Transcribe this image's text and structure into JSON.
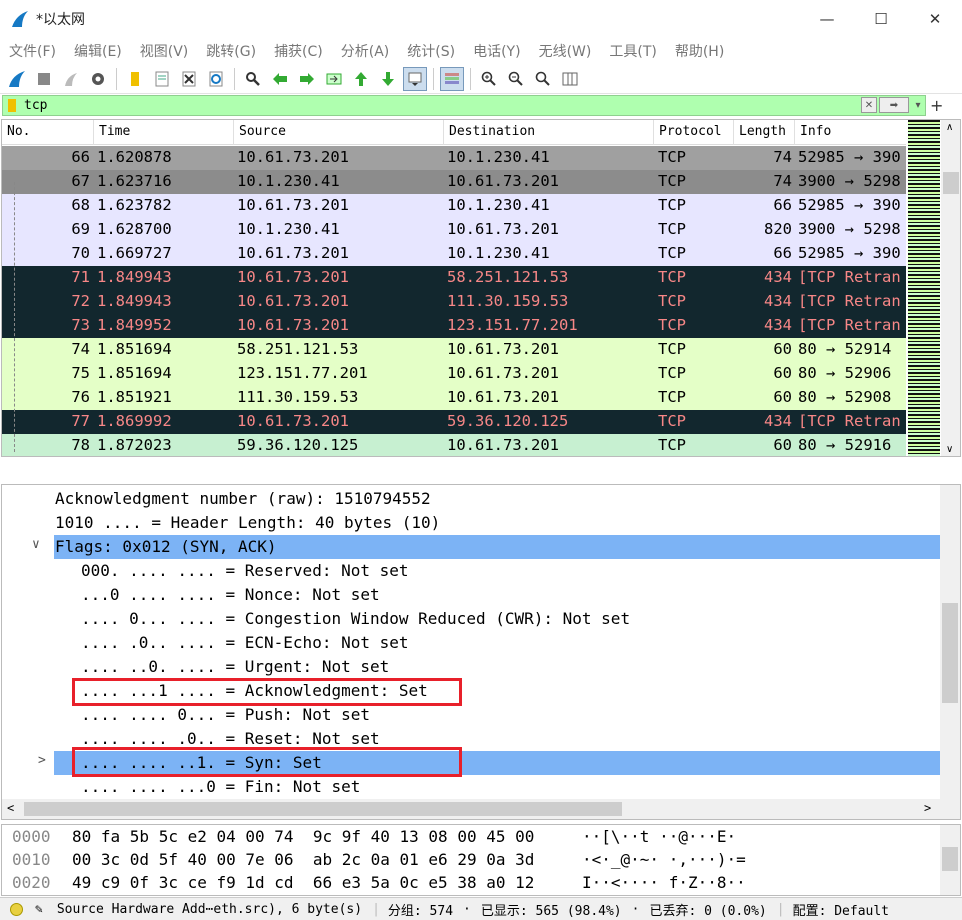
{
  "window": {
    "title": "*以太网",
    "minimize": "—",
    "maximize": "☐",
    "close": "✕"
  },
  "menu": [
    "文件(F)",
    "编辑(E)",
    "视图(V)",
    "跳转(G)",
    "捕获(C)",
    "分析(A)",
    "统计(S)",
    "电话(Y)",
    "无线(W)",
    "工具(T)",
    "帮助(H)"
  ],
  "filter": {
    "value": "tcp",
    "plus": "+"
  },
  "columns": [
    "No.",
    "Time",
    "Source",
    "Destination",
    "Protocol",
    "Length",
    "Info"
  ],
  "packets": [
    {
      "no": "66",
      "time": "1.620878",
      "src": "10.61.73.201",
      "dst": "10.1.230.41",
      "proto": "TCP",
      "len": "74",
      "info": "52985 → 390",
      "bg": "#a0a0a0",
      "fg": "#000"
    },
    {
      "no": "67",
      "time": "1.623716",
      "src": "10.1.230.41",
      "dst": "10.61.73.201",
      "proto": "TCP",
      "len": "74",
      "info": "3900 → 5298",
      "bg": "#8c8c8c",
      "fg": "#000"
    },
    {
      "no": "68",
      "time": "1.623782",
      "src": "10.61.73.201",
      "dst": "10.1.230.41",
      "proto": "TCP",
      "len": "66",
      "info": "52985 → 390",
      "bg": "#e7e6ff",
      "fg": "#000"
    },
    {
      "no": "69",
      "time": "1.628700",
      "src": "10.1.230.41",
      "dst": "10.61.73.201",
      "proto": "TCP",
      "len": "820",
      "info": "3900 → 5298",
      "bg": "#e7e6ff",
      "fg": "#000"
    },
    {
      "no": "70",
      "time": "1.669727",
      "src": "10.61.73.201",
      "dst": "10.1.230.41",
      "proto": "TCP",
      "len": "66",
      "info": "52985 → 390",
      "bg": "#e7e6ff",
      "fg": "#000"
    },
    {
      "no": "71",
      "time": "1.849943",
      "src": "10.61.73.201",
      "dst": "58.251.121.53",
      "proto": "TCP",
      "len": "434",
      "info": "[TCP Retran",
      "bg": "#12272e",
      "fg": "#f78787"
    },
    {
      "no": "72",
      "time": "1.849943",
      "src": "10.61.73.201",
      "dst": "111.30.159.53",
      "proto": "TCP",
      "len": "434",
      "info": "[TCP Retran",
      "bg": "#12272e",
      "fg": "#f78787"
    },
    {
      "no": "73",
      "time": "1.849952",
      "src": "10.61.73.201",
      "dst": "123.151.77.201",
      "proto": "TCP",
      "len": "434",
      "info": "[TCP Retran",
      "bg": "#12272e",
      "fg": "#f78787"
    },
    {
      "no": "74",
      "time": "1.851694",
      "src": "58.251.121.53",
      "dst": "10.61.73.201",
      "proto": "TCP",
      "len": "60",
      "info": "80 → 52914",
      "bg": "#e4ffc7",
      "fg": "#000"
    },
    {
      "no": "75",
      "time": "1.851694",
      "src": "123.151.77.201",
      "dst": "10.61.73.201",
      "proto": "TCP",
      "len": "60",
      "info": "80 → 52906",
      "bg": "#e4ffc7",
      "fg": "#000"
    },
    {
      "no": "76",
      "time": "1.851921",
      "src": "111.30.159.53",
      "dst": "10.61.73.201",
      "proto": "TCP",
      "len": "60",
      "info": "80 → 52908",
      "bg": "#e4ffc7",
      "fg": "#000"
    },
    {
      "no": "77",
      "time": "1.869992",
      "src": "10.61.73.201",
      "dst": "59.36.120.125",
      "proto": "TCP",
      "len": "434",
      "info": "[TCP Retran",
      "bg": "#12272e",
      "fg": "#f78787"
    },
    {
      "no": "78",
      "time": "1.872023",
      "src": "59.36.120.125",
      "dst": "10.61.73.201",
      "proto": "TCP",
      "len": "60",
      "info": "80 → 52916",
      "bg": "#c7f0d1",
      "fg": "#000"
    }
  ],
  "details": [
    {
      "indent": 0,
      "text": "Acknowledgment number (raw): 1510794552",
      "sel": false,
      "arrow": ""
    },
    {
      "indent": 0,
      "text": "1010 .... = Header Length: 40 bytes (10)",
      "sel": false,
      "arrow": ""
    },
    {
      "indent": 0,
      "text": "Flags: 0x012 (SYN, ACK)",
      "sel": true,
      "arrow": "∨"
    },
    {
      "indent": 1,
      "text": "000. .... .... = Reserved: Not set",
      "sel": false,
      "arrow": ""
    },
    {
      "indent": 1,
      "text": "...0 .... .... = Nonce: Not set",
      "sel": false,
      "arrow": ""
    },
    {
      "indent": 1,
      "text": ".... 0... .... = Congestion Window Reduced (CWR): Not set",
      "sel": false,
      "arrow": ""
    },
    {
      "indent": 1,
      "text": ".... .0.. .... = ECN-Echo: Not set",
      "sel": false,
      "arrow": ""
    },
    {
      "indent": 1,
      "text": ".... ..0. .... = Urgent: Not set",
      "sel": false,
      "arrow": ""
    },
    {
      "indent": 1,
      "text": ".... ...1 .... = Acknowledgment: Set",
      "sel": false,
      "arrow": ""
    },
    {
      "indent": 1,
      "text": ".... .... 0... = Push: Not set",
      "sel": false,
      "arrow": ""
    },
    {
      "indent": 1,
      "text": ".... .... .0.. = Reset: Not set",
      "sel": false,
      "arrow": ""
    },
    {
      "indent": 1,
      "text": ".... .... ..1. = Syn: Set",
      "sel": true,
      "arrow": ">"
    },
    {
      "indent": 1,
      "text": ".... .... ...0 = Fin: Not set",
      "sel": false,
      "arrow": ""
    }
  ],
  "bytes": [
    {
      "off": "0000",
      "hex": "80 fa 5b 5c e2 04 00 74  9c 9f 40 13 08 00 45 00",
      "ascii": "··[\\··t ··@···E·"
    },
    {
      "off": "0010",
      "hex": "00 3c 0d 5f 40 00 7e 06  ab 2c 0a 01 e6 29 0a 3d",
      "ascii": "·<·_@·~· ·,···)·="
    },
    {
      "off": "0020",
      "hex": "49 c9 0f 3c ce f9 1d cd  66 e3 5a 0c e5 38 a0 12",
      "ascii": "I··<···· f·Z··8··"
    }
  ],
  "status": {
    "field": "Source Hardware Add⋯eth.src), 6 byte(s)",
    "groups": "分组: 574",
    "shown": "已显示: 565 (98.4%)",
    "dropped": "已丢弃: 0 (0.0%)",
    "profile": "配置: Default"
  }
}
